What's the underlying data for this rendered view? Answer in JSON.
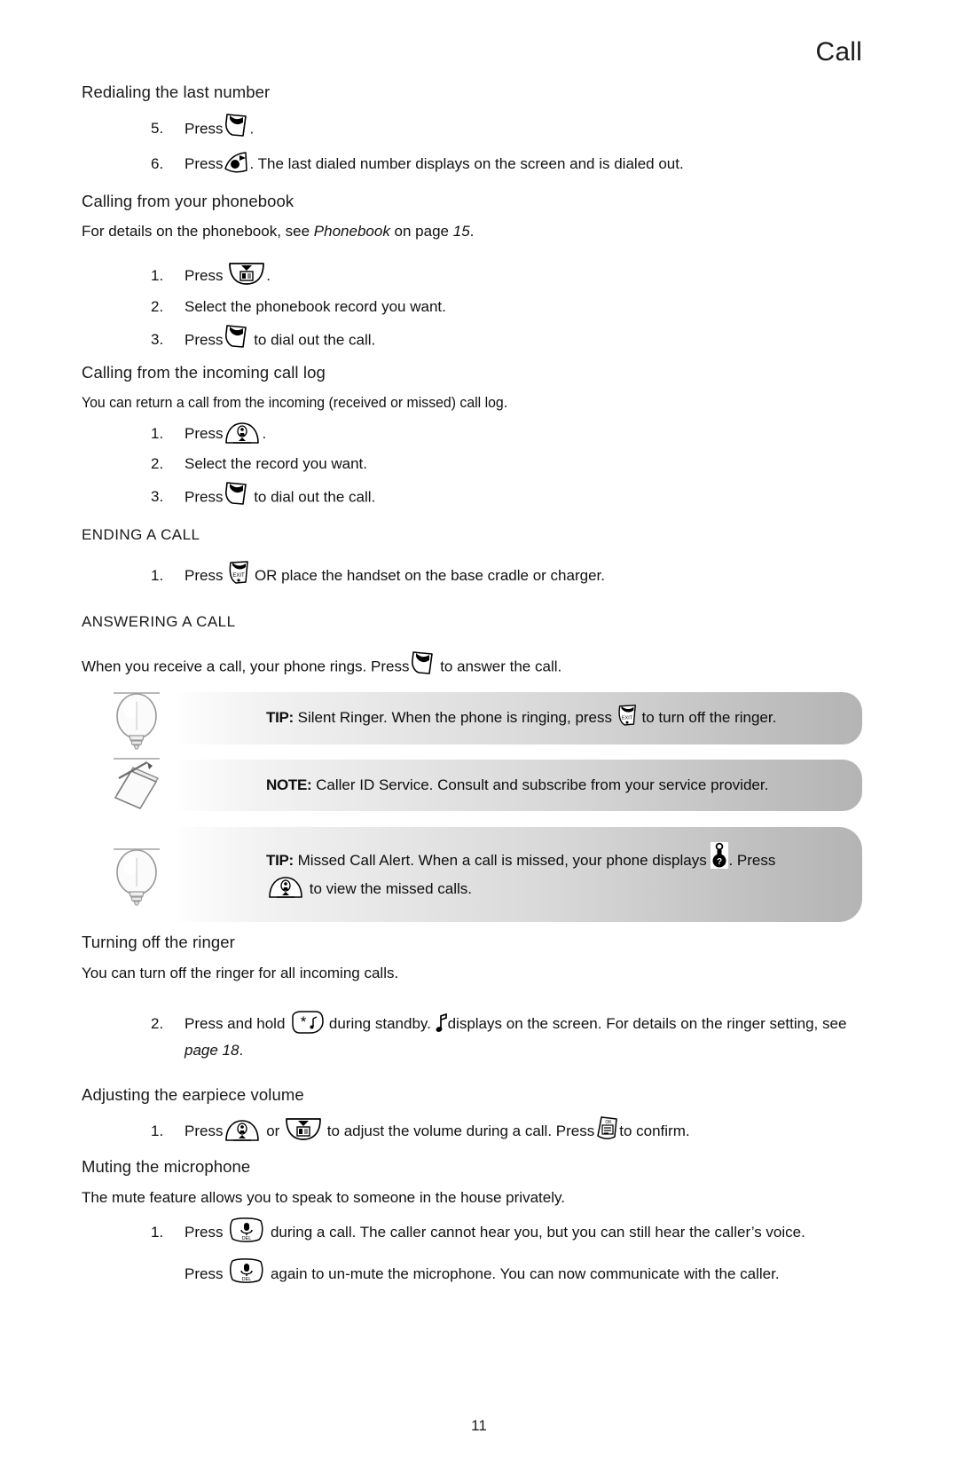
{
  "header": {
    "chapter_title": "Call"
  },
  "sections": {
    "redial": {
      "heading": "Redialing the last number",
      "steps": [
        {
          "num": "5.",
          "before": "Press",
          "icon": "talk-key-icon",
          "after": "."
        },
        {
          "num": "6.",
          "before": "Press",
          "icon": "redial-key-icon",
          "after": ". The last dialed number displays on the screen and is dialed out."
        }
      ]
    },
    "phonebook": {
      "heading": "Calling from your phonebook",
      "intro_prefix": "For details on the phonebook, see ",
      "intro_italic": "Phonebook",
      "intro_middle": " on page ",
      "intro_italic2": "15",
      "intro_suffix": ".",
      "steps": [
        {
          "num": "1.",
          "before": "Press",
          "icon": "phonebook-key-icon",
          "after": "."
        },
        {
          "num": "2.",
          "before": "Select the phonebook record you want.",
          "icon": "",
          "after": ""
        },
        {
          "num": "3.",
          "before": "Press",
          "icon": "talk-key-icon",
          "after": "to dial out the call."
        }
      ]
    },
    "incoming_log": {
      "heading": "Calling from the incoming call log",
      "intro": "You can return a call from the incoming (received or missed) call log.",
      "steps": [
        {
          "num": "1.",
          "before": "Press",
          "icon": "nav-up-key-icon",
          "after": "."
        },
        {
          "num": "2.",
          "before": "Select the record you want.",
          "icon": "",
          "after": ""
        },
        {
          "num": "3.",
          "before": "Press",
          "icon": "talk-key-icon",
          "after": "to dial out the call."
        }
      ]
    },
    "ending_call": {
      "heading": "ENDING A CALL",
      "steps": [
        {
          "num": "1.",
          "before": "Press",
          "icon": "exit-key-icon",
          "after": "OR place the handset on the base cradle or charger."
        }
      ]
    },
    "answering_call": {
      "heading": "ANSWERING A CALL",
      "intro_before": "When you receive a call, your phone rings. Press",
      "intro_icon": "talk-key-icon",
      "intro_after": "to answer the call."
    },
    "turning_off_ringer": {
      "heading": "Turning off the ringer",
      "intro": "You can turn off the ringer for all incoming calls.",
      "steps": [
        {
          "num": "2.",
          "before": "Press and hold",
          "icon": "star-key-icon",
          "middle": "during standby.",
          "icon2": "music-note-icon",
          "after": "displays on the screen. For details on the ringer setting, see ",
          "italic_ref": "page 18",
          "after2": "."
        }
      ]
    },
    "earpiece_volume": {
      "heading": "Adjusting the earpiece volume",
      "steps": [
        {
          "num": "1.",
          "before": "Press",
          "icon": "nav-up-key-icon",
          "middle": "or",
          "icon2": "phonebook-key-icon",
          "after": "to adjust the volume during a call. Press",
          "icon3": "ok-key-icon",
          "after2": "to confirm."
        }
      ]
    },
    "muting_microphone": {
      "heading": "Muting the microphone",
      "intro": "The mute feature allows you to speak to someone in the house privately.",
      "steps": [
        {
          "num": "1.",
          "before": "Press",
          "icon": "del-mute-key-icon",
          "after": "during a call. The caller cannot hear you, but you can still hear the caller’s voice."
        }
      ],
      "followup": {
        "before": "Press",
        "icon": "del-mute-key-icon",
        "after": "again to un-mute the microphone. You can now communicate with the caller."
      }
    }
  },
  "callouts": [
    {
      "icon": "lightbulb-icon",
      "label": "TIP:",
      "text_before": " Silent Ringer. When the phone is ringing, press",
      "inline_icon": "exit-key-icon",
      "text_after": "to turn off the ringer."
    },
    {
      "icon": "note-paper-pencil-icon",
      "label": "NOTE:",
      "text_before": " Caller ID Service. Consult and subscribe from your service provider.",
      "inline_icon": "",
      "text_after": ""
    },
    {
      "icon": "lightbulb-icon",
      "label": "TIP:",
      "text_before": " Missed Call Alert. When a call is missed, your phone displays",
      "inline_icon": "missed-call-icon",
      "text_mid": ". Press",
      "inline_icon2": "nav-up-key-icon",
      "text_after": "to view the missed calls."
    }
  ],
  "footer": {
    "page_number": "11"
  },
  "colors": {
    "text": "#111111",
    "callout_light": "#fefefe",
    "callout_dark": "#b4b4b4"
  }
}
